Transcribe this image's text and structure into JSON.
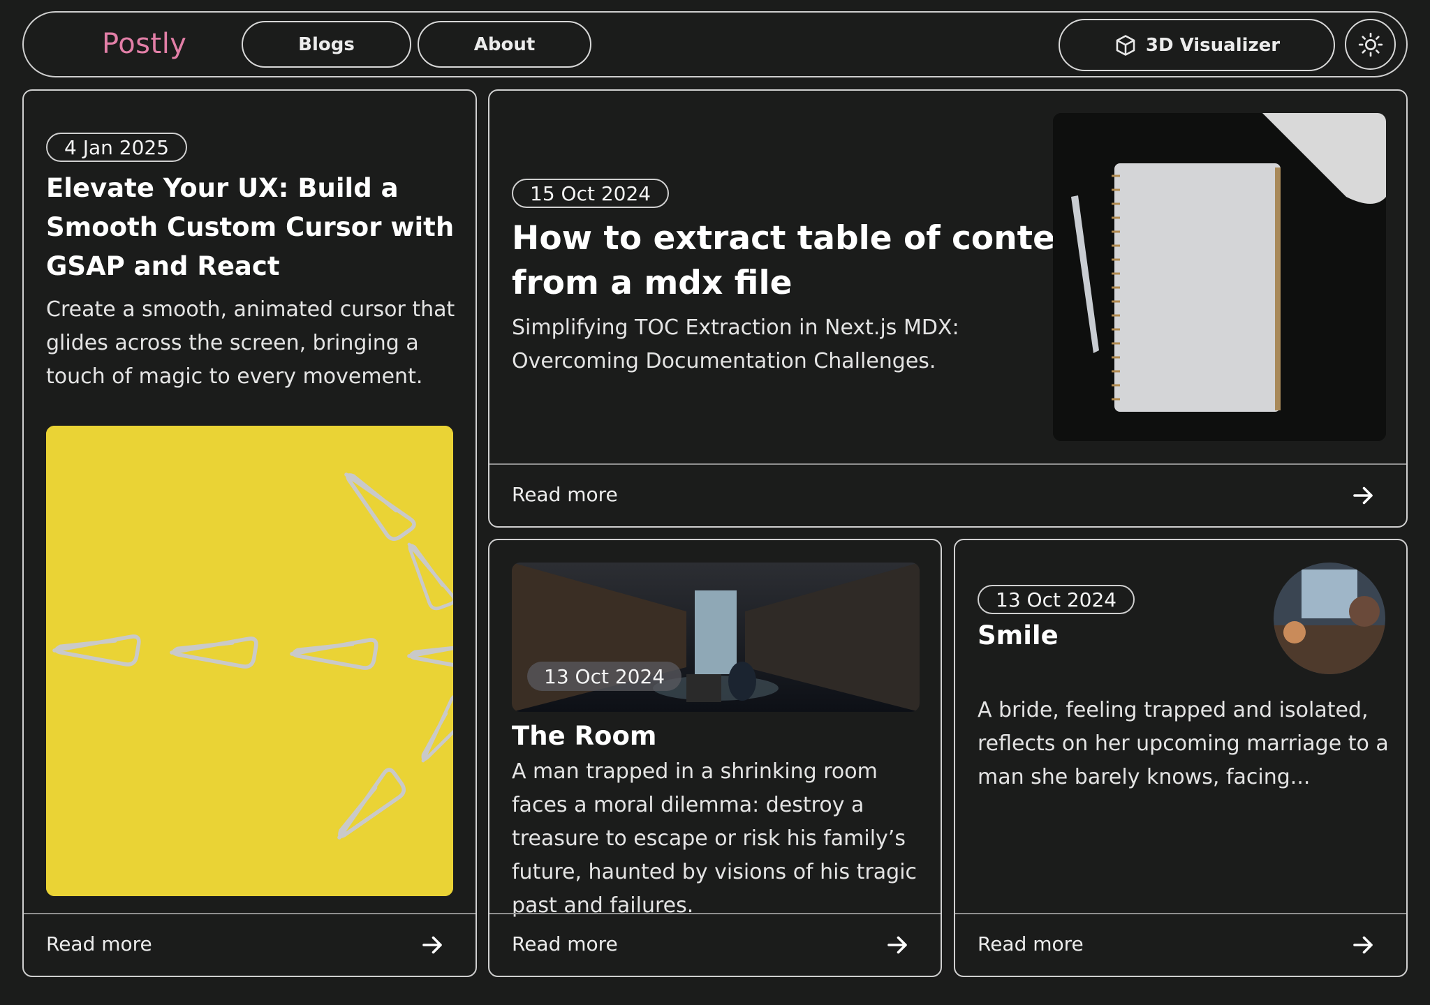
{
  "nav": {
    "brand": "Postly",
    "blogs_label": "Blogs",
    "about_label": "About",
    "visualizer_label": "3D Visualizer",
    "brand_color": "#e27fa7"
  },
  "cards": [
    {
      "date": "4 Jan 2025",
      "title_lines": [
        "Elevate Your UX: Build a",
        "Smooth Custom Cursor with",
        "GSAP and React"
      ],
      "desc_lines": [
        "Create a smooth, animated cursor that",
        "glides across the screen, bringing a",
        "touch of magic to every movement."
      ],
      "read_more": "Read more",
      "image": "yellow-paperclips"
    },
    {
      "date": "15 Oct 2024",
      "title_lines": [
        "How to extract table of contents",
        "from a mdx file"
      ],
      "desc_lines": [
        "Simplifying TOC Extraction in Next.js MDX:",
        "Overcoming Documentation Challenges."
      ],
      "read_more": "Read more",
      "image": "notebook-pen"
    },
    {
      "date": "13 Oct 2024",
      "title": "The Room",
      "desc_lines": [
        "A man trapped in a shrinking room",
        "faces a moral dilemma: destroy a",
        "treasure to escape or risk his family’s",
        "future, haunted by visions of his tragic",
        "past and failures."
      ],
      "read_more": "Read more",
      "image": "library-room"
    },
    {
      "date": "13 Oct 2024",
      "title": "Smile",
      "desc_lines": [
        "A bride, feeling trapped and isolated,",
        "reflects on her upcoming marriage to a",
        "man she barely knows, facing..."
      ],
      "read_more": "Read more",
      "image": "bride-avatar"
    }
  ]
}
